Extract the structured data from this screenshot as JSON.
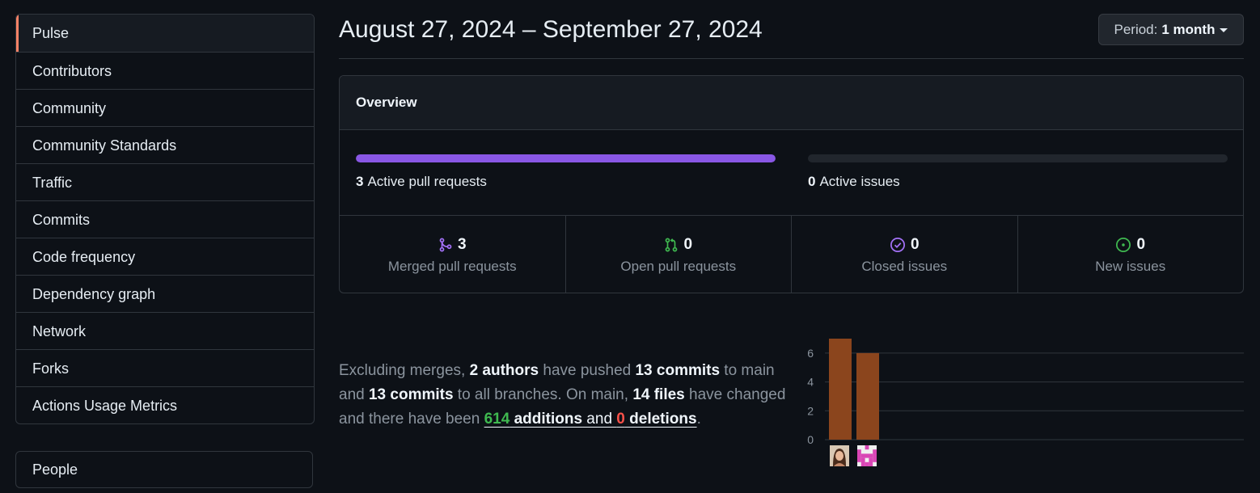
{
  "sidebar": {
    "items": [
      {
        "label": "Pulse",
        "active": true
      },
      {
        "label": "Contributors"
      },
      {
        "label": "Community"
      },
      {
        "label": "Community Standards"
      },
      {
        "label": "Traffic"
      },
      {
        "label": "Commits"
      },
      {
        "label": "Code frequency"
      },
      {
        "label": "Dependency graph"
      },
      {
        "label": "Network"
      },
      {
        "label": "Forks"
      },
      {
        "label": "Actions Usage Metrics"
      }
    ],
    "people_label": "People"
  },
  "header": {
    "date_range": "August 27, 2024 – September 27, 2024",
    "period_prefix": "Period:",
    "period_value": "1 month"
  },
  "overview": {
    "title": "Overview",
    "active_pull_requests": {
      "count": "3",
      "label": "Active pull requests",
      "fill_fraction": 1.0
    },
    "active_issues": {
      "count": "0",
      "label": "Active issues",
      "fill_fraction": 0.0
    },
    "stats": [
      {
        "count": "3",
        "label": "Merged pull requests",
        "icon": "merge-icon",
        "color": "#a371f7"
      },
      {
        "count": "0",
        "label": "Open pull requests",
        "icon": "pull-request-icon",
        "color": "#3fb950"
      },
      {
        "count": "0",
        "label": "Closed issues",
        "icon": "issue-closed-icon",
        "color": "#a371f7"
      },
      {
        "count": "0",
        "label": "New issues",
        "icon": "issue-opened-icon",
        "color": "#3fb950"
      }
    ]
  },
  "summary": {
    "t1": "Excluding merges, ",
    "authors": "2 authors",
    "t2": " have pushed ",
    "commits_main": "13 commits",
    "t3": " to main and ",
    "commits_all": "13 commits",
    "t4": " to all branches. On main, ",
    "files": "14 files",
    "t5": " have changed and there have been ",
    "additions_num": "614",
    "additions_word": " additions",
    "t6": " and ",
    "deletions_num": "0",
    "deletions_word": " deletions",
    "t7": "."
  },
  "chart_data": {
    "type": "bar",
    "categories": [
      "author-1",
      "author-2"
    ],
    "values": [
      7,
      6
    ],
    "yticks": [
      "0",
      "2",
      "4",
      "6"
    ],
    "ylim": [
      0,
      7
    ],
    "bar_color": "#8b451d",
    "grid": true
  },
  "colors": {
    "accent_active": "#f78166",
    "purple": "#8957e5",
    "green": "#3fb950",
    "red": "#f85149"
  }
}
